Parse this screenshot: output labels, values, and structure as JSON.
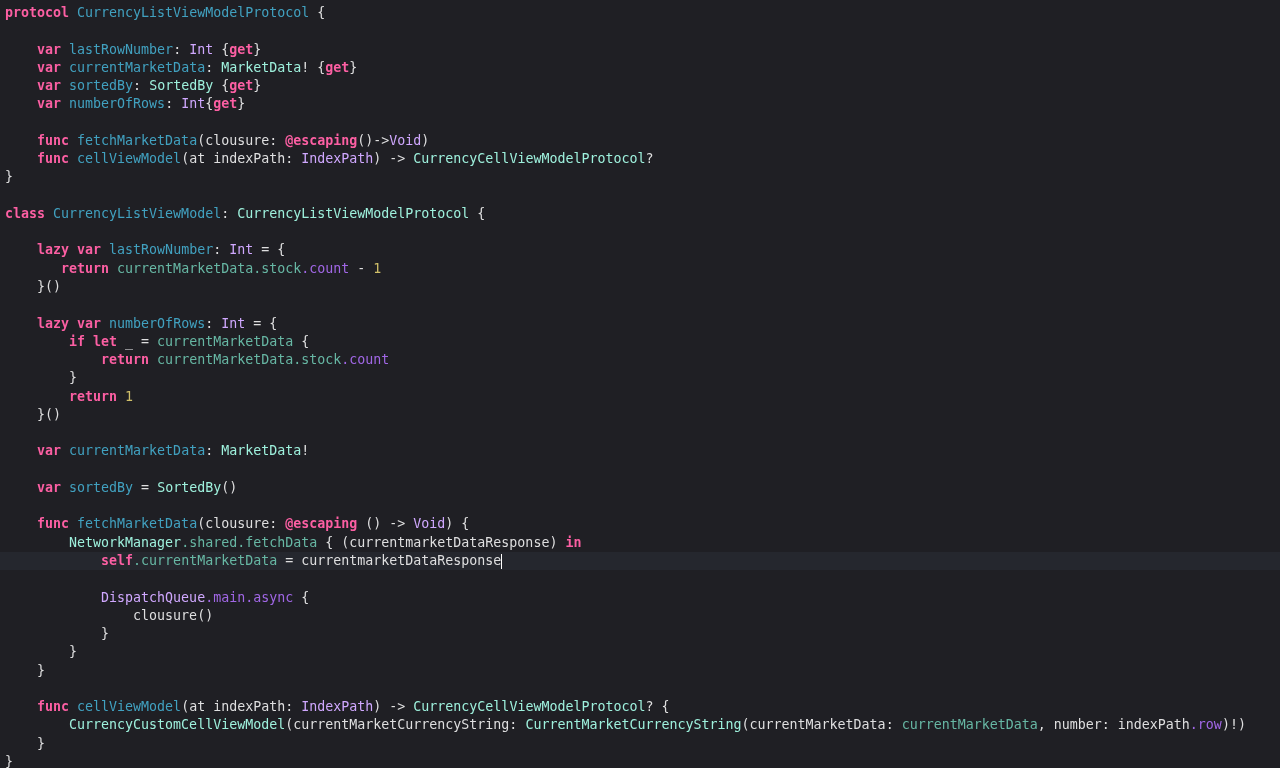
{
  "editor": {
    "lines": [
      {
        "kind": "code",
        "current": false,
        "tokens": [
          {
            "kind": "kw",
            "text": "protocol"
          },
          {
            "kind": "decl",
            "text": " CurrencyListViewModelProtocol"
          },
          {
            "kind": "plain",
            "text": " {"
          }
        ]
      },
      {
        "kind": "blank"
      },
      {
        "kind": "code",
        "current": false,
        "tokens": [
          {
            "kind": "kw",
            "text": "    var"
          },
          {
            "kind": "decl",
            "text": " lastRowNumber"
          },
          {
            "kind": "plain",
            "text": ": "
          },
          {
            "kind": "systype",
            "text": "Int"
          },
          {
            "kind": "plain",
            "text": " {"
          },
          {
            "kind": "kw",
            "text": "get"
          },
          {
            "kind": "plain",
            "text": "}"
          }
        ]
      },
      {
        "kind": "code",
        "current": false,
        "tokens": [
          {
            "kind": "kw",
            "text": "    var"
          },
          {
            "kind": "decl",
            "text": " currentMarketData"
          },
          {
            "kind": "plain",
            "text": ": "
          },
          {
            "kind": "type",
            "text": "MarketData"
          },
          {
            "kind": "plain",
            "text": "! {"
          },
          {
            "kind": "kw",
            "text": "get"
          },
          {
            "kind": "plain",
            "text": "}"
          }
        ]
      },
      {
        "kind": "code",
        "current": false,
        "tokens": [
          {
            "kind": "kw",
            "text": "    var"
          },
          {
            "kind": "decl",
            "text": " sortedBy"
          },
          {
            "kind": "plain",
            "text": ": "
          },
          {
            "kind": "type",
            "text": "SortedBy"
          },
          {
            "kind": "plain",
            "text": " {"
          },
          {
            "kind": "kw",
            "text": "get"
          },
          {
            "kind": "plain",
            "text": "}"
          }
        ]
      },
      {
        "kind": "code",
        "current": false,
        "tokens": [
          {
            "kind": "kw",
            "text": "    var"
          },
          {
            "kind": "decl",
            "text": " numberOfRows"
          },
          {
            "kind": "plain",
            "text": ": "
          },
          {
            "kind": "systype",
            "text": "Int"
          },
          {
            "kind": "plain",
            "text": "{"
          },
          {
            "kind": "kw",
            "text": "get"
          },
          {
            "kind": "plain",
            "text": "}"
          }
        ]
      },
      {
        "kind": "blank"
      },
      {
        "kind": "code",
        "current": false,
        "tokens": [
          {
            "kind": "kw",
            "text": "    func"
          },
          {
            "kind": "decl",
            "text": " fetchMarketData"
          },
          {
            "kind": "plain",
            "text": "(clousure: "
          },
          {
            "kind": "kw",
            "text": "@escaping"
          },
          {
            "kind": "plain",
            "text": "()->"
          },
          {
            "kind": "systype",
            "text": "Void"
          },
          {
            "kind": "plain",
            "text": ")"
          }
        ]
      },
      {
        "kind": "code",
        "current": false,
        "tokens": [
          {
            "kind": "kw",
            "text": "    func"
          },
          {
            "kind": "decl",
            "text": " cellViewModel"
          },
          {
            "kind": "plain",
            "text": "(at indexPath: "
          },
          {
            "kind": "systype",
            "text": "IndexPath"
          },
          {
            "kind": "plain",
            "text": ") -> "
          },
          {
            "kind": "type",
            "text": "CurrencyCellViewModelProtocol"
          },
          {
            "kind": "plain",
            "text": "?"
          }
        ]
      },
      {
        "kind": "code",
        "current": false,
        "tokens": [
          {
            "kind": "plain",
            "text": "}"
          }
        ]
      },
      {
        "kind": "blank"
      },
      {
        "kind": "code",
        "current": false,
        "tokens": [
          {
            "kind": "kw",
            "text": "class"
          },
          {
            "kind": "decl",
            "text": " CurrencyListViewModel"
          },
          {
            "kind": "plain",
            "text": ": "
          },
          {
            "kind": "type",
            "text": "CurrencyListViewModelProtocol"
          },
          {
            "kind": "plain",
            "text": " {"
          }
        ]
      },
      {
        "kind": "blank"
      },
      {
        "kind": "code",
        "current": false,
        "tokens": [
          {
            "kind": "kw",
            "text": "    lazy var"
          },
          {
            "kind": "decl",
            "text": " lastRowNumber"
          },
          {
            "kind": "plain",
            "text": ": "
          },
          {
            "kind": "systype",
            "text": "Int"
          },
          {
            "kind": "plain",
            "text": " = {"
          }
        ]
      },
      {
        "kind": "code",
        "current": false,
        "tokens": [
          {
            "kind": "kw",
            "text": "       return"
          },
          {
            "kind": "prop",
            "text": " currentMarketData"
          },
          {
            "kind": "prop",
            "text": ".stock"
          },
          {
            "kind": "sysprop",
            "text": ".count"
          },
          {
            "kind": "plain",
            "text": " - "
          },
          {
            "kind": "num",
            "text": "1"
          }
        ]
      },
      {
        "kind": "code",
        "current": false,
        "tokens": [
          {
            "kind": "plain",
            "text": "    }()"
          }
        ]
      },
      {
        "kind": "blank"
      },
      {
        "kind": "code",
        "current": false,
        "tokens": [
          {
            "kind": "kw",
            "text": "    lazy var"
          },
          {
            "kind": "decl",
            "text": " numberOfRows"
          },
          {
            "kind": "plain",
            "text": ": "
          },
          {
            "kind": "systype",
            "text": "Int"
          },
          {
            "kind": "plain",
            "text": " = {"
          }
        ]
      },
      {
        "kind": "code",
        "current": false,
        "tokens": [
          {
            "kind": "kw",
            "text": "        if let"
          },
          {
            "kind": "plain",
            "text": " _ = "
          },
          {
            "kind": "prop",
            "text": "currentMarketData"
          },
          {
            "kind": "plain",
            "text": " {"
          }
        ]
      },
      {
        "kind": "code",
        "current": false,
        "tokens": [
          {
            "kind": "kw",
            "text": "            return"
          },
          {
            "kind": "prop",
            "text": " currentMarketData"
          },
          {
            "kind": "prop",
            "text": ".stock"
          },
          {
            "kind": "sysprop",
            "text": ".count"
          }
        ]
      },
      {
        "kind": "code",
        "current": false,
        "tokens": [
          {
            "kind": "plain",
            "text": "        }"
          }
        ]
      },
      {
        "kind": "code",
        "current": false,
        "tokens": [
          {
            "kind": "kw",
            "text": "        return"
          },
          {
            "kind": "num",
            "text": " 1"
          }
        ]
      },
      {
        "kind": "code",
        "current": false,
        "tokens": [
          {
            "kind": "plain",
            "text": "    }()"
          }
        ]
      },
      {
        "kind": "blank"
      },
      {
        "kind": "code",
        "current": false,
        "tokens": [
          {
            "kind": "kw",
            "text": "    var"
          },
          {
            "kind": "decl",
            "text": " currentMarketData"
          },
          {
            "kind": "plain",
            "text": ": "
          },
          {
            "kind": "type",
            "text": "MarketData"
          },
          {
            "kind": "plain",
            "text": "!"
          }
        ]
      },
      {
        "kind": "blank"
      },
      {
        "kind": "code",
        "current": false,
        "tokens": [
          {
            "kind": "kw",
            "text": "    var"
          },
          {
            "kind": "decl",
            "text": " sortedBy"
          },
          {
            "kind": "plain",
            "text": " = "
          },
          {
            "kind": "type",
            "text": "SortedBy"
          },
          {
            "kind": "plain",
            "text": "()"
          }
        ]
      },
      {
        "kind": "blank"
      },
      {
        "kind": "code",
        "current": false,
        "tokens": [
          {
            "kind": "kw",
            "text": "    func"
          },
          {
            "kind": "decl",
            "text": " fetchMarketData"
          },
          {
            "kind": "plain",
            "text": "(clousure: "
          },
          {
            "kind": "kw",
            "text": "@escaping"
          },
          {
            "kind": "plain",
            "text": " () -> "
          },
          {
            "kind": "systype",
            "text": "Void"
          },
          {
            "kind": "plain",
            "text": ") {"
          }
        ]
      },
      {
        "kind": "code",
        "current": false,
        "tokens": [
          {
            "kind": "type",
            "text": "        NetworkManager"
          },
          {
            "kind": "prop",
            "text": ".shared"
          },
          {
            "kind": "prop",
            "text": ".fetchData"
          },
          {
            "kind": "plain",
            "text": " { (currentmarketDataResponse) "
          },
          {
            "kind": "kw",
            "text": "in"
          }
        ]
      },
      {
        "kind": "code",
        "current": true,
        "tokens": [
          {
            "kind": "kw",
            "text": "            self"
          },
          {
            "kind": "prop",
            "text": ".currentMarketData"
          },
          {
            "kind": "plain",
            "text": " = currentmarketDataResponse"
          }
        ]
      },
      {
        "kind": "blank"
      },
      {
        "kind": "code",
        "current": false,
        "tokens": [
          {
            "kind": "systype",
            "text": "            DispatchQueue"
          },
          {
            "kind": "sysprop",
            "text": ".main"
          },
          {
            "kind": "sysprop",
            "text": ".async"
          },
          {
            "kind": "plain",
            "text": " {"
          }
        ]
      },
      {
        "kind": "code",
        "current": false,
        "tokens": [
          {
            "kind": "plain",
            "text": "                clousure()"
          }
        ]
      },
      {
        "kind": "code",
        "current": false,
        "tokens": [
          {
            "kind": "plain",
            "text": "            }"
          }
        ]
      },
      {
        "kind": "code",
        "current": false,
        "tokens": [
          {
            "kind": "plain",
            "text": "        }"
          }
        ]
      },
      {
        "kind": "code",
        "current": false,
        "tokens": [
          {
            "kind": "plain",
            "text": "    }"
          }
        ]
      },
      {
        "kind": "blank"
      },
      {
        "kind": "code",
        "current": false,
        "tokens": [
          {
            "kind": "kw",
            "text": "    func"
          },
          {
            "kind": "decl",
            "text": " cellViewModel"
          },
          {
            "kind": "plain",
            "text": "(at indexPath: "
          },
          {
            "kind": "systype",
            "text": "IndexPath"
          },
          {
            "kind": "plain",
            "text": ") -> "
          },
          {
            "kind": "type",
            "text": "CurrencyCellViewModelProtocol"
          },
          {
            "kind": "plain",
            "text": "? {"
          }
        ]
      },
      {
        "kind": "code",
        "current": false,
        "tokens": [
          {
            "kind": "type",
            "text": "        CurrencyCustomCellViewModel"
          },
          {
            "kind": "plain",
            "text": "(currentMarketCurrencyString: "
          },
          {
            "kind": "type",
            "text": "CurrentMarketCurrencyString"
          },
          {
            "kind": "plain",
            "text": "(currentMarketData: "
          },
          {
            "kind": "prop",
            "text": "currentMarketData"
          },
          {
            "kind": "plain",
            "text": ", number: indexPath"
          },
          {
            "kind": "sysprop",
            "text": ".row"
          },
          {
            "kind": "plain",
            "text": ")!)"
          }
        ]
      },
      {
        "kind": "code",
        "current": false,
        "tokens": [
          {
            "kind": "plain",
            "text": "    }"
          }
        ]
      },
      {
        "kind": "code",
        "current": false,
        "tokens": [
          {
            "kind": "plain",
            "text": "}"
          }
        ]
      }
    ]
  }
}
